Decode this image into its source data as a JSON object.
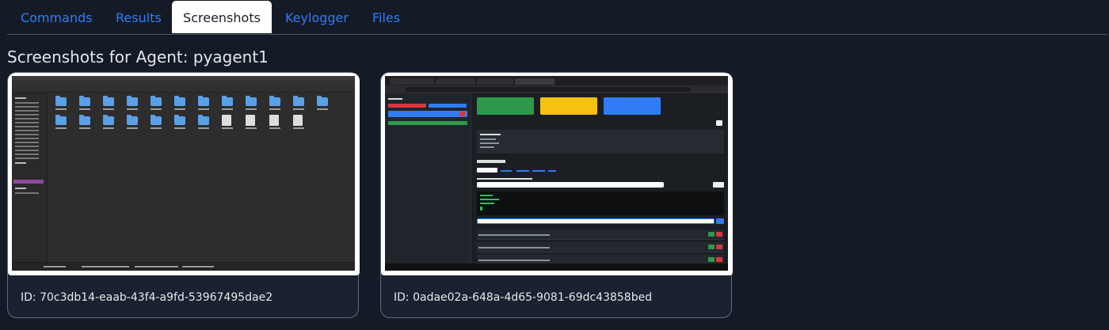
{
  "tabs": [
    {
      "label": "Commands",
      "active": false
    },
    {
      "label": "Results",
      "active": false
    },
    {
      "label": "Screenshots",
      "active": true
    },
    {
      "label": "Keylogger",
      "active": false
    },
    {
      "label": "Files",
      "active": false
    }
  ],
  "page_title": "Screenshots for Agent: pyagent1",
  "screenshots": [
    {
      "id_text": "ID: 70c3db14-eaab-43f4-a9fd-53967495dae2",
      "thumbnail": "file-manager-screenshot"
    },
    {
      "id_text": "ID: 0adae02a-648a-4d65-9081-69dc43858bed",
      "thumbnail": "browser-dashboard-screenshot"
    }
  ],
  "colors": {
    "background": "#141b26",
    "tab_link": "#2f7cf6",
    "card_border": "#5d6b82"
  }
}
